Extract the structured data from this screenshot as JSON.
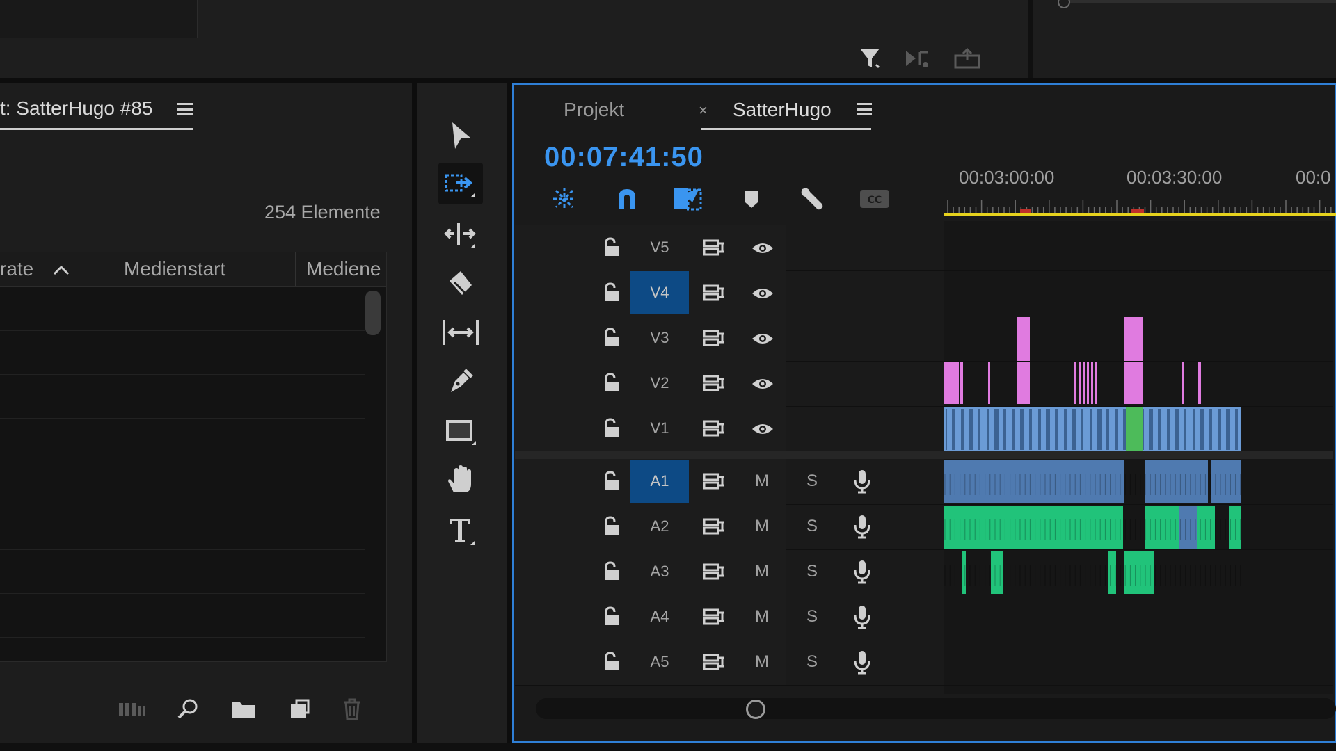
{
  "project_panel": {
    "tab_title": "t: SatterHugo #85",
    "item_count": "254 Elemente",
    "columns": [
      {
        "label": "rate"
      },
      {
        "label": "Medienstart"
      },
      {
        "label": "Mediene"
      }
    ],
    "rows": [
      "",
      "",
      "",
      "",
      "",
      "",
      "",
      ""
    ],
    "bottom_icons": [
      "list-view-icon",
      "search-icon",
      "new-bin-icon",
      "new-item-icon",
      "trash-icon"
    ]
  },
  "tools": [
    "selection-tool-icon",
    "track-select-forward-icon",
    "ripple-edit-icon",
    "razor-icon",
    "slip-icon",
    "pen-icon",
    "rectangle-icon",
    "hand-icon",
    "type-icon"
  ],
  "timeline": {
    "tabs": [
      {
        "label": "Projekt"
      },
      {
        "label": "SatterHugo"
      }
    ],
    "close_glyph": "×",
    "timecode": "00:07:41:50",
    "ruler_labels": [
      "00:03:00:00",
      "00:03:30:00",
      "00:0"
    ],
    "video_tracks": [
      {
        "name": "V5",
        "selected": false
      },
      {
        "name": "V4",
        "selected": true
      },
      {
        "name": "V3",
        "selected": false
      },
      {
        "name": "V2",
        "selected": false
      },
      {
        "name": "V1",
        "selected": false
      }
    ],
    "audio_tracks": [
      {
        "name": "A1",
        "selected": true,
        "mute": "M",
        "solo": "S"
      },
      {
        "name": "A2",
        "selected": false,
        "mute": "M",
        "solo": "S"
      },
      {
        "name": "A3",
        "selected": false,
        "mute": "M",
        "solo": "S"
      },
      {
        "name": "A4",
        "selected": false,
        "mute": "M",
        "solo": "S"
      },
      {
        "name": "A5",
        "selected": false,
        "mute": "M",
        "solo": "S"
      }
    ]
  },
  "colors": {
    "accent": "#2f7fd6",
    "timecode": "#3a95f0",
    "video_clip": "#6b9bd6",
    "graphic_clip": "#e07be0",
    "audio_clip": "#21c37a",
    "work_area": "#e6d21d"
  }
}
